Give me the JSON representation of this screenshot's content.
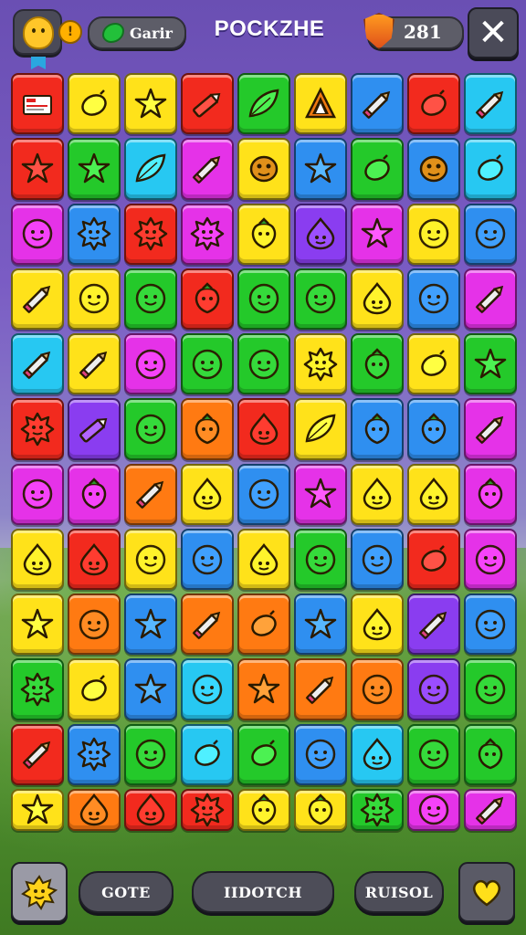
{
  "header": {
    "player_name": "Garir",
    "coin_glyph": "!",
    "title": "POCKZHE",
    "score": "281",
    "close_glyph": "✕"
  },
  "board": {
    "columns": 9,
    "rows": 11,
    "tiles": [
      [
        "red:card",
        "yellow:lemon",
        "yellow:star",
        "red:crayon",
        "green:leaf",
        "yellow:cone",
        "blue:pencil",
        "red:lemon",
        "cyan:pencil"
      ],
      [
        "red:star",
        "green:star",
        "cyan:leaf",
        "magenta:pencil",
        "yellow:blob",
        "blue:star",
        "green:lemon",
        "blue:blob",
        "cyan:lemon"
      ],
      [
        "magenta:face",
        "blue:spiky",
        "red:spiky",
        "magenta:spiky",
        "yellow:berry",
        "purple:drop",
        "magenta:star",
        "yellow:face",
        "blue:face"
      ],
      [
        "yellow:pencil",
        "yellow:face",
        "green:face",
        "red:berry",
        "green:face",
        "green:face",
        "yellow:drop",
        "blue:face",
        "magenta:pencil"
      ],
      [
        "cyan:pencil",
        "yellow:pencil",
        "magenta:face",
        "green:face",
        "green:face",
        "yellow:spiky",
        "green:berry",
        "yellow:lemon",
        "green:star"
      ],
      [
        "red:spiky",
        "purple:crayon",
        "green:face",
        "orange:berry",
        "red:drop",
        "yellow:leaf",
        "blue:berry",
        "blue:berry",
        "magenta:pencil"
      ],
      [
        "magenta:face",
        "magenta:berry",
        "orange:pencil",
        "yellow:drop",
        "blue:face",
        "magenta:star",
        "yellow:drop",
        "yellow:drop",
        "magenta:berry"
      ],
      [
        "yellow:drop",
        "red:drop",
        "yellow:face",
        "blue:face",
        "yellow:drop",
        "green:face",
        "blue:face",
        "red:lemon",
        "magenta:face"
      ],
      [
        "yellow:star",
        "orange:face",
        "blue:star",
        "orange:pencil",
        "orange:lemon",
        "blue:star",
        "yellow:drop",
        "purple:pencil",
        "blue:face"
      ],
      [
        "green:spiky",
        "yellow:lemon",
        "blue:star",
        "cyan:face",
        "orange:star",
        "orange:pencil",
        "orange:face",
        "purple:face",
        "green:face"
      ],
      [
        "red:pencil",
        "blue:spiky",
        "green:face",
        "cyan:lemon",
        "green:lemon",
        "blue:face",
        "cyan:drop",
        "green:face",
        "green:berry"
      ],
      [
        "yellow:star",
        "orange:drop",
        "red:drop",
        "red:spiky",
        "yellow:berry",
        "yellow:berry",
        "green:spiky",
        "magenta:face",
        "magenta:pencil"
      ]
    ]
  },
  "footer": {
    "btn_left_label": "GOTE",
    "btn_middle_label": "IIDOTCH",
    "btn_right_label": "RUISOL"
  },
  "colors": {
    "red": "#f22a1e",
    "yellow": "#ffe21a",
    "green": "#24c92a",
    "blue": "#2f8ff0",
    "cyan": "#27c8f2",
    "magenta": "#e532e8",
    "purple": "#8a3df0",
    "orange": "#ff7a12"
  },
  "icons": [
    "card-icon",
    "lemon-icon",
    "star-icon",
    "crayon-icon",
    "leaf-icon",
    "cone-icon",
    "pencil-icon",
    "blob-icon",
    "face-icon",
    "spiky-icon",
    "berry-icon",
    "drop-icon",
    "sun-face-icon",
    "heart-icon",
    "close-icon",
    "shield-icon",
    "coin-icon"
  ]
}
